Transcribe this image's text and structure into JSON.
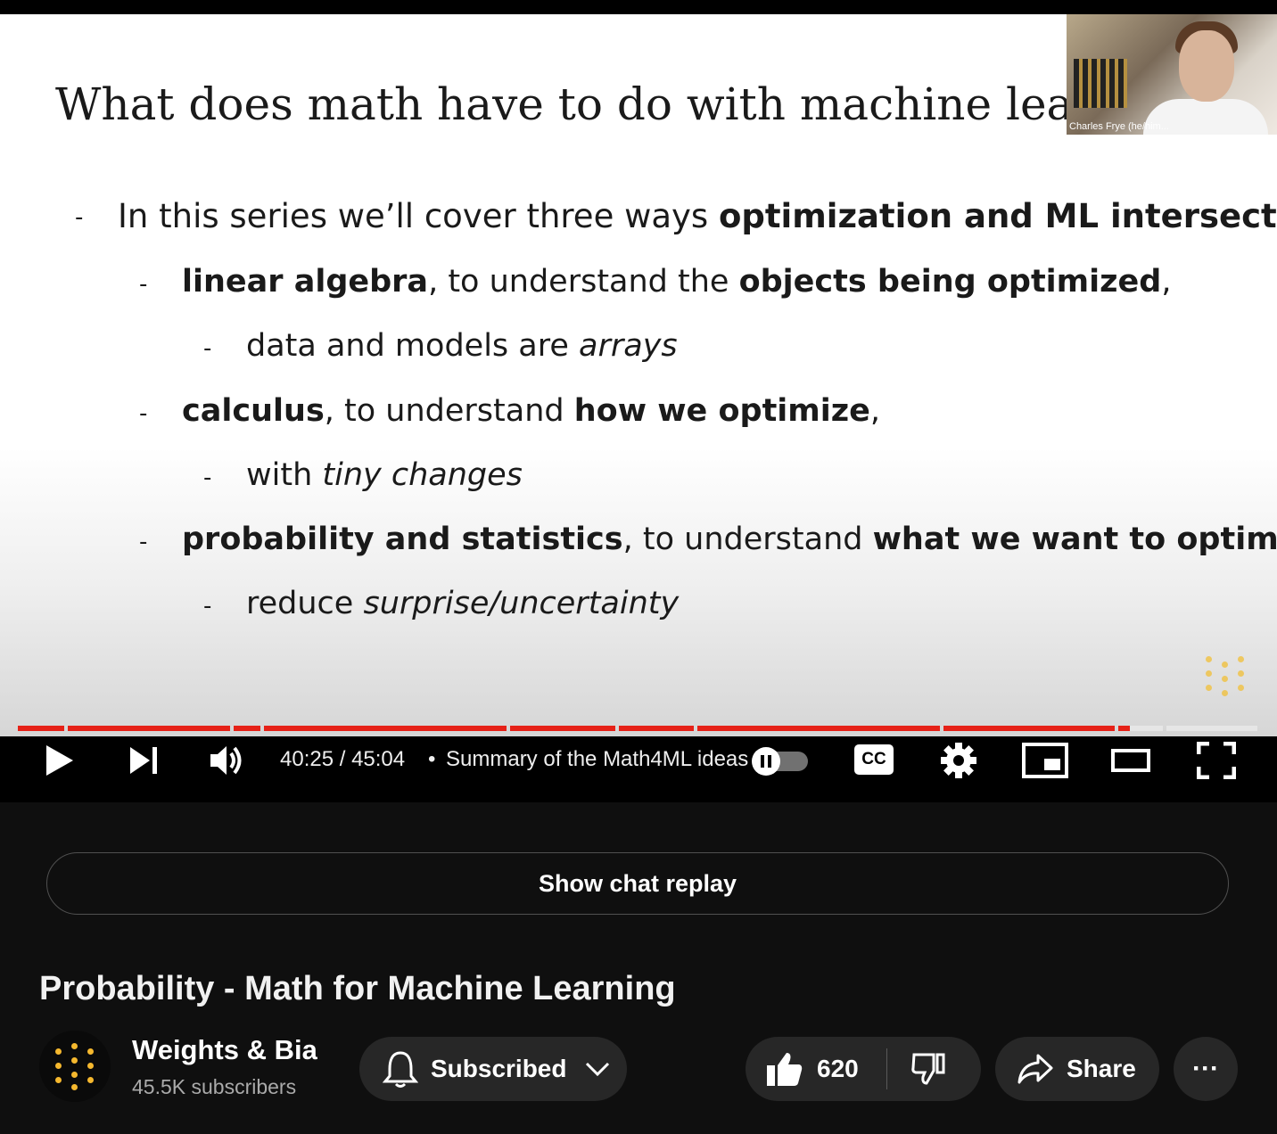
{
  "slide": {
    "title": "What does math have to do with machine lear",
    "bullets": [
      {
        "level": 1,
        "parts": [
          {
            "t": "In this series we’ll cover three ways ",
            "s": ""
          },
          {
            "t": "optimization and ML intersect",
            "s": "b"
          },
          {
            "t": ":",
            "s": ""
          }
        ]
      },
      {
        "level": 2,
        "parts": [
          {
            "t": "linear algebra",
            "s": "b"
          },
          {
            "t": ", to understand the ",
            "s": ""
          },
          {
            "t": "objects being optimized",
            "s": "b"
          },
          {
            "t": ",",
            "s": ""
          }
        ]
      },
      {
        "level": 3,
        "parts": [
          {
            "t": "data and models are ",
            "s": ""
          },
          {
            "t": "arrays",
            "s": "i"
          }
        ]
      },
      {
        "level": 2,
        "parts": [
          {
            "t": "calculus",
            "s": "b"
          },
          {
            "t": ", to understand ",
            "s": ""
          },
          {
            "t": "how we optimize",
            "s": "b"
          },
          {
            "t": ",",
            "s": ""
          }
        ]
      },
      {
        "level": 3,
        "parts": [
          {
            "t": "with ",
            "s": ""
          },
          {
            "t": "tiny changes",
            "s": "i"
          }
        ]
      },
      {
        "level": 2,
        "parts": [
          {
            "t": "probability and statistics",
            "s": "b"
          },
          {
            "t": ", to understand ",
            "s": ""
          },
          {
            "t": "what we want to optimize",
            "s": "b"
          },
          {
            "t": ".",
            "s": ""
          }
        ]
      },
      {
        "level": 3,
        "parts": [
          {
            "t": "reduce ",
            "s": ""
          },
          {
            "t": "surprise/uncertainty",
            "s": "i"
          }
        ]
      }
    ],
    "dash": "-"
  },
  "webcam": {
    "name": "Charles Frye (he/him..."
  },
  "player": {
    "time": "40:25 / 45:04",
    "separator": "•",
    "chapter": "Summary of the Math4ML ideas",
    "progress_fraction": 0.897,
    "played_color": "#e62117",
    "unplayed_color": "#9a9a9a",
    "icons": [
      "play-icon",
      "next-icon",
      "volume-icon",
      "autoplay-toggle-icon",
      "captions-icon",
      "settings-icon",
      "miniplayer-icon",
      "theater-icon",
      "fullscreen-icon"
    ],
    "cc_label": "CC"
  },
  "chat_replay": {
    "label": "Show chat replay"
  },
  "video": {
    "title": "Probability - Math for Machine Learning"
  },
  "channel": {
    "name": "Weights & Biases",
    "subscribers": "45.5K subscribers",
    "accent_color": "#f5b82e"
  },
  "actions": {
    "subscribed_label": "Subscribed",
    "like_count": "620",
    "share_label": "Share",
    "more_label": "···"
  }
}
